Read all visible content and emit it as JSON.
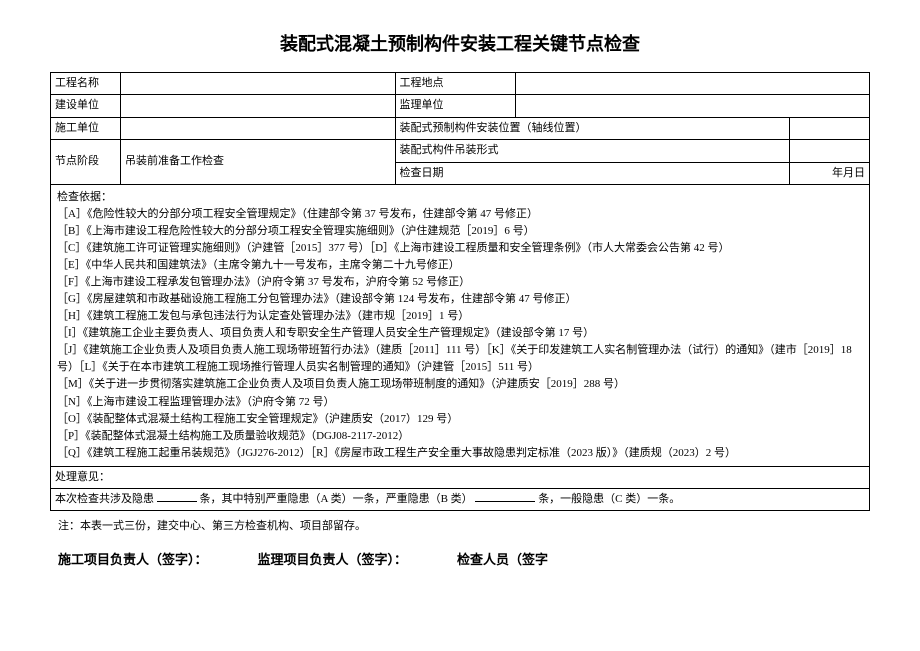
{
  "title": "装配式混凝土预制构件安装工程关键节点检查",
  "header": {
    "project_name_label": "工程名称",
    "project_name": "",
    "project_location_label": "工程地点",
    "project_location": "",
    "build_unit_label": "建设单位",
    "build_unit": "",
    "supervise_unit_label": "监理单位",
    "supervise_unit": "",
    "construct_unit_label": "施工单位",
    "construct_unit": "",
    "install_pos_label": "装配式预制构件安装位置（轴线位置）",
    "install_pos": "",
    "stage_label": "节点阶段",
    "stage_value": "吊装前准备工作检查",
    "hoist_form_label": "装配式构件吊装形式",
    "hoist_form": "",
    "check_date_label": "检查日期",
    "check_date_value": "年月日"
  },
  "basis_label": "检查依据：",
  "basis_items": [
    "［A］《危险性较大的分部分项工程安全管理规定》（住建部令第 37 号发布，住建部令第 47 号修正）",
    "［B］《上海市建设工程危险性较大的分部分项工程安全管理实施细则》（沪住建规范［2019］6 号）",
    "［C］《建筑施工许可证管理实施细则》（沪建管［2015］377 号）［D］《上海市建设工程质量和安全管理条例》（市人大常委会公告第 42 号）",
    "［E］《中华人民共和国建筑法》（主席令第九十一号发布，主席令第二十九号修正）",
    "［F］《上海市建设工程承发包管理办法》（沪府令第 37 号发布，沪府令第 52 号修正）",
    "［G］《房屋建筑和市政基础设施工程施工分包管理办法》（建设部令第 124 号发布，住建部令第 47 号修正）",
    "［H］《建筑工程施工发包与承包违法行为认定查处管理办法》（建市规［2019］1 号）",
    "［I］《建筑施工企业主要负责人、项目负责人和专职安全生产管理人员安全生产管理规定》（建设部令第 17 号）",
    "［J］《建筑施工企业负责人及项目负责人施工现场带班暂行办法》（建质［2011］111 号）［K］《关于印发建筑工人实名制管理办法（试行）的通知》（建市［2019］18 号）［L］《关于在本市建筑工程施工现场推行管理人员实名制管理的通知》（沪建管［2015］511 号）",
    "［M］《关于进一步贯彻落实建筑施工企业负责人及项目负责人施工现场带班制度的通知》（沪建质安［2019］288 号）",
    "［N］《上海市建设工程监理管理办法》（沪府令第 72 号）",
    "［O］《装配整体式混凝土结构工程施工安全管理规定》（沪建质安（2017）129 号）",
    "［P］《装配整体式混凝土结构施工及质量验收规范》（DGJ08-2117-2012）",
    "［Q］《建筑工程施工起重吊装规范》（JGJ276-2012）［R］《房屋市政工程生产安全重大事故隐患判定标准（2023 版）》（建质规（2023）2 号）"
  ],
  "opinion_label": "处理意见：",
  "summary": {
    "prefix": "本次检查共涉及隐患",
    "unit1": "条，其中特别严重隐患（A 类）一条，严重隐患（B 类）",
    "unit2": "条，一般隐患（C 类）一条。"
  },
  "footnote": "注：本表一式三份，建交中心、第三方检查机构、项目部留存。",
  "sign": {
    "constructor": "施工项目负责人（签字）：",
    "supervisor": "监理项目负责人（签字）：",
    "inspector": "检查人员（签字"
  }
}
